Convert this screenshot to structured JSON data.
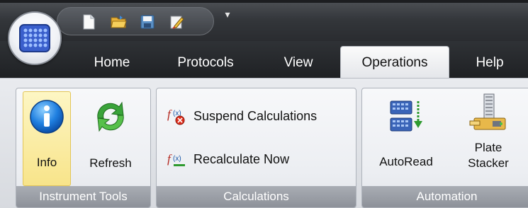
{
  "tabs": [
    {
      "label": "Home"
    },
    {
      "label": "Protocols"
    },
    {
      "label": "View"
    },
    {
      "label": "Operations"
    },
    {
      "label": "Help"
    }
  ],
  "quick_access": [
    "new-file-icon",
    "open-folder-icon",
    "save-icon",
    "edit-document-icon"
  ],
  "groups": {
    "instrument_tools": {
      "label": "Instrument Tools",
      "info": "Info",
      "refresh": "Refresh"
    },
    "calculations": {
      "label": "Calculations",
      "suspend": "Suspend Calculations",
      "recalculate": "Recalculate Now"
    },
    "automation": {
      "label": "Automation",
      "autoread": "AutoRead",
      "plate_stacker_1": "Plate",
      "plate_stacker_2": "Stacker"
    }
  },
  "colors": {
    "accent_pressed": "#f8e48a",
    "dark_bar": "#2a2c30"
  }
}
